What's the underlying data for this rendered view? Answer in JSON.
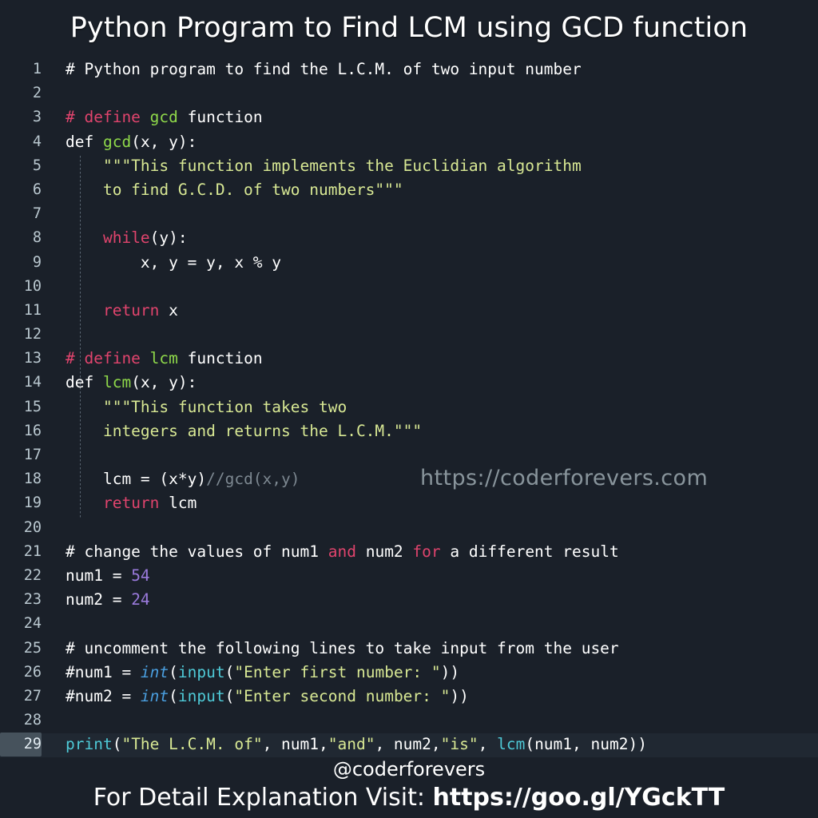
{
  "title": "Python Program to Find LCM using GCD function",
  "watermark": "https://coderforevers.com",
  "footer": {
    "handle": "@coderforevers",
    "cta_prefix": "For Detail Explanation Visit: ",
    "cta_link": "https://goo.gl/YGckTT"
  },
  "colors": {
    "background": "#1a2029",
    "line_number": "#b9c7cf",
    "default_text": "#ffffff",
    "comment_pink": "#e0446d",
    "keyword_pink": "#e0446d",
    "function_green": "#8fd94a",
    "string_yellow_green": "#d8e894",
    "number_purple": "#9b7bdd",
    "builtin_cyan": "#4ec9d6",
    "type_blue": "#4a9fe0",
    "active_line": "#202832",
    "active_gutter": "#46525c"
  },
  "editor": {
    "active_line_number": 29,
    "lines": [
      {
        "n": 1,
        "tokens": [
          {
            "t": "# Python program to find the L.C.M. of two input number",
            "c": "tok-comment-plain"
          }
        ]
      },
      {
        "n": 2,
        "tokens": []
      },
      {
        "n": 3,
        "tokens": [
          {
            "t": "# define ",
            "c": "tok-comment"
          },
          {
            "t": "gcd",
            "c": "tok-func"
          },
          {
            "t": " function",
            "c": "tok-default"
          }
        ]
      },
      {
        "n": 4,
        "tokens": [
          {
            "t": "def ",
            "c": "tok-default"
          },
          {
            "t": "gcd",
            "c": "tok-func"
          },
          {
            "t": "(x, y):",
            "c": "tok-default"
          }
        ]
      },
      {
        "n": 5,
        "tokens": [
          {
            "t": "    \"\"\"This function implements the Euclidian algorithm",
            "c": "tok-string"
          }
        ]
      },
      {
        "n": 6,
        "tokens": [
          {
            "t": "    to find G.C.D. of two numbers\"\"\"",
            "c": "tok-string"
          }
        ]
      },
      {
        "n": 7,
        "tokens": []
      },
      {
        "n": 8,
        "tokens": [
          {
            "t": "    ",
            "c": "tok-default"
          },
          {
            "t": "while",
            "c": "tok-keyword"
          },
          {
            "t": "(y):",
            "c": "tok-default"
          }
        ]
      },
      {
        "n": 9,
        "tokens": [
          {
            "t": "        x, y = y, x % y",
            "c": "tok-default"
          }
        ]
      },
      {
        "n": 10,
        "tokens": []
      },
      {
        "n": 11,
        "tokens": [
          {
            "t": "    ",
            "c": "tok-default"
          },
          {
            "t": "return",
            "c": "tok-keyword"
          },
          {
            "t": " x",
            "c": "tok-default"
          }
        ]
      },
      {
        "n": 12,
        "tokens": []
      },
      {
        "n": 13,
        "tokens": [
          {
            "t": "# define ",
            "c": "tok-comment"
          },
          {
            "t": "lcm",
            "c": "tok-func"
          },
          {
            "t": " function",
            "c": "tok-default"
          }
        ]
      },
      {
        "n": 14,
        "tokens": [
          {
            "t": "def ",
            "c": "tok-default"
          },
          {
            "t": "lcm",
            "c": "tok-func"
          },
          {
            "t": "(x, y):",
            "c": "tok-default"
          }
        ]
      },
      {
        "n": 15,
        "tokens": [
          {
            "t": "    \"\"\"This function takes two",
            "c": "tok-string"
          }
        ]
      },
      {
        "n": 16,
        "tokens": [
          {
            "t": "    integers and returns the L.C.M.\"\"\"",
            "c": "tok-string"
          }
        ]
      },
      {
        "n": 17,
        "tokens": []
      },
      {
        "n": 18,
        "tokens": [
          {
            "t": "    lcm = (x*y)",
            "c": "tok-default"
          },
          {
            "t": "//gcd(x,y)",
            "c": "tok-dim"
          }
        ]
      },
      {
        "n": 19,
        "tokens": [
          {
            "t": "    ",
            "c": "tok-default"
          },
          {
            "t": "return",
            "c": "tok-keyword"
          },
          {
            "t": " lcm",
            "c": "tok-default"
          }
        ]
      },
      {
        "n": 20,
        "tokens": []
      },
      {
        "n": 21,
        "tokens": [
          {
            "t": "# change the values of num1 ",
            "c": "tok-default"
          },
          {
            "t": "and",
            "c": "tok-keyword"
          },
          {
            "t": " num2 ",
            "c": "tok-default"
          },
          {
            "t": "for",
            "c": "tok-keyword"
          },
          {
            "t": " a different result",
            "c": "tok-default"
          }
        ]
      },
      {
        "n": 22,
        "tokens": [
          {
            "t": "num1 = ",
            "c": "tok-default"
          },
          {
            "t": "54",
            "c": "tok-number"
          }
        ]
      },
      {
        "n": 23,
        "tokens": [
          {
            "t": "num2 = ",
            "c": "tok-default"
          },
          {
            "t": "24",
            "c": "tok-number"
          }
        ]
      },
      {
        "n": 24,
        "tokens": []
      },
      {
        "n": 25,
        "tokens": [
          {
            "t": "# uncomment the following lines to take input from the user",
            "c": "tok-default"
          }
        ]
      },
      {
        "n": 26,
        "tokens": [
          {
            "t": "#num1 = ",
            "c": "tok-default"
          },
          {
            "t": "int",
            "c": "tok-type"
          },
          {
            "t": "(",
            "c": "tok-default"
          },
          {
            "t": "input",
            "c": "tok-builtin"
          },
          {
            "t": "(",
            "c": "tok-default"
          },
          {
            "t": "\"Enter first number: \"",
            "c": "tok-string"
          },
          {
            "t": "))",
            "c": "tok-default"
          }
        ]
      },
      {
        "n": 27,
        "tokens": [
          {
            "t": "#num2 = ",
            "c": "tok-default"
          },
          {
            "t": "int",
            "c": "tok-type"
          },
          {
            "t": "(",
            "c": "tok-default"
          },
          {
            "t": "input",
            "c": "tok-builtin"
          },
          {
            "t": "(",
            "c": "tok-default"
          },
          {
            "t": "\"Enter second number: \"",
            "c": "tok-string"
          },
          {
            "t": "))",
            "c": "tok-default"
          }
        ]
      },
      {
        "n": 28,
        "tokens": []
      },
      {
        "n": 29,
        "tokens": [
          {
            "t": "print",
            "c": "tok-builtin"
          },
          {
            "t": "(",
            "c": "tok-default"
          },
          {
            "t": "\"The L.C.M. of\"",
            "c": "tok-string"
          },
          {
            "t": ", num1,",
            "c": "tok-default"
          },
          {
            "t": "\"and\"",
            "c": "tok-string"
          },
          {
            "t": ", num2,",
            "c": "tok-default"
          },
          {
            "t": "\"is\"",
            "c": "tok-string"
          },
          {
            "t": ", ",
            "c": "tok-default"
          },
          {
            "t": "lcm",
            "c": "tok-call"
          },
          {
            "t": "(num1, num2))",
            "c": "tok-default"
          }
        ]
      }
    ]
  }
}
